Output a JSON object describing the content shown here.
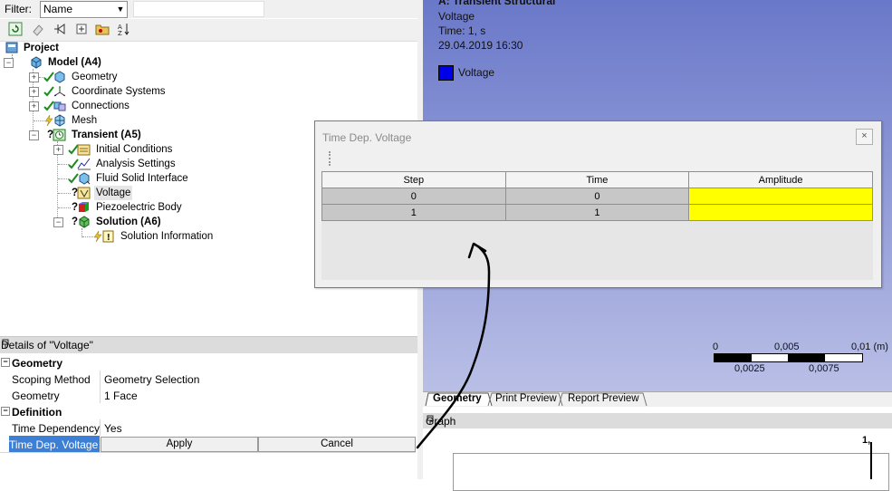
{
  "filter": {
    "label": "Filter:",
    "select_value": "Name",
    "input_value": ""
  },
  "toolbar": {
    "icons": [
      "refresh-icon",
      "eraser-icon",
      "pin-graph-icon",
      "expand-all-icon",
      "folder-icon",
      "sort-az-icon"
    ]
  },
  "tree": {
    "project": "Project",
    "model": "Model (A4)",
    "geometry": "Geometry",
    "coordinate_systems": "Coordinate Systems",
    "connections": "Connections",
    "mesh": "Mesh",
    "transient": "Transient (A5)",
    "initial_conditions": "Initial Conditions",
    "analysis_settings": "Analysis Settings",
    "fluid_solid_interface": "Fluid Solid Interface",
    "voltage": "Voltage",
    "piezoelectric_body": "Piezoelectric Body",
    "solution": "Solution (A6)",
    "solution_information": "Solution Information"
  },
  "details": {
    "title": "Details of \"Voltage\"",
    "section_geometry": "Geometry",
    "scoping_method_label": "Scoping Method",
    "scoping_method_value": "Geometry Selection",
    "geometry_label": "Geometry",
    "geometry_value": "1 Face",
    "section_definition": "Definition",
    "time_dependency_label": "Time Dependency",
    "time_dependency_value": "Yes",
    "time_dep_voltage_label": "Time Dep. Voltage",
    "apply_label": "Apply",
    "cancel_label": "Cancel"
  },
  "graphics": {
    "title": "A: Transient Structural",
    "subtitle": "Voltage",
    "time": "Time: 1, s",
    "date": "29.04.2019 16:30",
    "legend_label": "Voltage",
    "legend_color": "#0000e6",
    "scale_top": [
      "0",
      "0,005",
      "0,01 (m)"
    ],
    "scale_bottom": [
      "0,0025",
      "0,0075"
    ]
  },
  "tabs": {
    "geometry": "Geometry",
    "print_preview": "Print Preview",
    "report_preview": "Report Preview"
  },
  "graph": {
    "title": "Graph",
    "y_max": "1,"
  },
  "dialog": {
    "title": "Time Dep. Voltage",
    "close": "×",
    "headers": [
      "Step",
      "Time",
      "Amplitude"
    ],
    "rows": [
      {
        "step": "0",
        "time": "0",
        "amplitude": ""
      },
      {
        "step": "1",
        "time": "1",
        "amplitude": ""
      }
    ],
    "amplitude_color": "#ffff00"
  },
  "annotation": {
    "type": "hand-drawn-arrow",
    "color": "#000000"
  }
}
